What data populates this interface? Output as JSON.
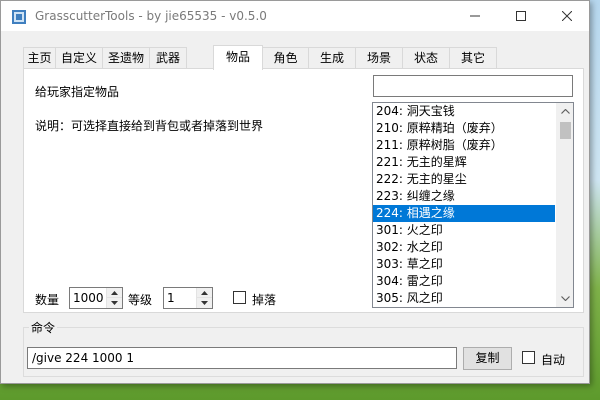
{
  "window": {
    "title": "GrasscutterTools  - by jie65535  - v0.5.0",
    "minimize_icon": "minimize-icon",
    "maximize_icon": "maximize-icon",
    "close_icon": "close-icon"
  },
  "tabs": [
    {
      "label": "主页"
    },
    {
      "label": "自定义"
    },
    {
      "label": "圣遗物"
    },
    {
      "label": "武器"
    },
    {
      "label": "物品",
      "active": true
    },
    {
      "label": "角色"
    },
    {
      "label": "生成"
    },
    {
      "label": "场景"
    },
    {
      "label": "状态"
    },
    {
      "label": "其它"
    }
  ],
  "items_page": {
    "heading": "给玩家指定物品",
    "description": "说明：可选择直接给到背包或者掉落到世界",
    "filter_value": "",
    "list": [
      "204: 洞天宝钱",
      "210: 原粹精珀（废弃）",
      "211: 原粹树脂（废弃）",
      "221: 无主的星辉",
      "222: 无主的星尘",
      "223: 纠缠之缘",
      "224: 相遇之缘",
      "301: 火之印",
      "302: 水之印",
      "303: 草之印",
      "304: 雷之印",
      "305: 风之印"
    ],
    "selected_index": 6,
    "amount_label": "数量",
    "amount_value": "1000",
    "level_label": "等级",
    "level_value": "1",
    "drop_label": "掉落",
    "drop_checked": false
  },
  "command": {
    "group_label": "命令",
    "value": "/give 224 1000 1",
    "copy_label": "复制",
    "auto_label": "自动",
    "auto_checked": false
  },
  "colors": {
    "selection": "#0078d7",
    "window_bg": "#f0f0f0",
    "panel_bg": "#ffffff"
  }
}
